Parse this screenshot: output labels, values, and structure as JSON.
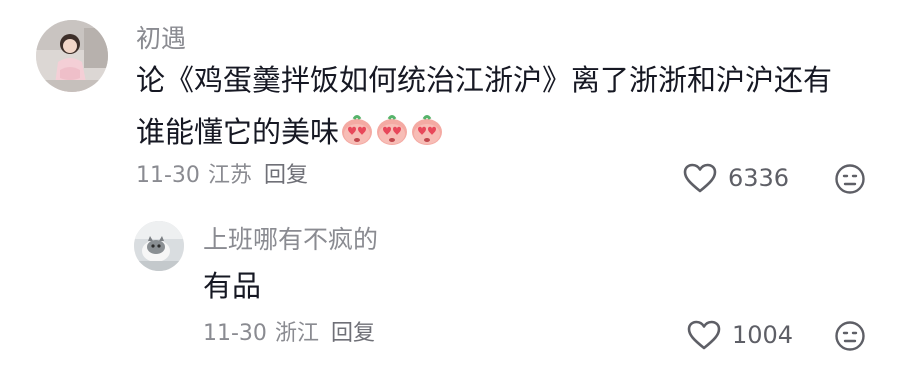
{
  "comments": [
    {
      "username": "初遇",
      "text_line1": "论《鸡蛋羹拌饭如何统治江浙沪》离了浙浙和沪沪还有",
      "text_line2": "谁能懂它的美味",
      "emoji_icons": [
        "heart-eyes-emoji",
        "heart-eyes-emoji",
        "heart-eyes-emoji"
      ],
      "date": "11-30",
      "location": "江苏",
      "reply_label": "回复",
      "likes": "6336"
    },
    {
      "username": "上班哪有不疯的",
      "text": "有品",
      "date": "11-30",
      "location": "浙江",
      "reply_label": "回复",
      "likes": "1004"
    }
  ],
  "colors": {
    "username": "#8a8b91",
    "text": "#161823",
    "meta": "#8a8b91",
    "icon": "#5e5f66",
    "emoji_face": "#f2a7a1",
    "emoji_heart": "#e8485a",
    "emoji_leaf": "#56b36a"
  }
}
